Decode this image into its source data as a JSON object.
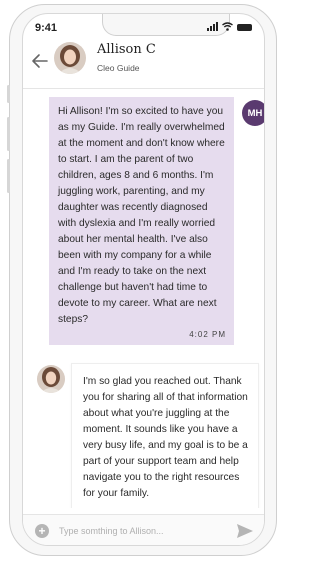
{
  "status_bar": {
    "time": "9:41"
  },
  "header": {
    "name": "Allison C",
    "subtitle": "Cleo Guide"
  },
  "messages": [
    {
      "sender_initials": "MH",
      "text": "Hi Allison! I'm so excited to have you as my Guide. I'm really overwhelmed at the moment and don't know where to start. I am the parent of two children, ages 8 and 6 months. I'm juggling work, parenting, and my daughter was recently diagnosed with dyslexia and I'm really worried about her mental health. I've also been with my company for a while and I'm ready to take on the next challenge but haven't had time to devote to my career. What are next steps?",
      "time": "4:02 PM"
    },
    {
      "text": "I'm so glad you reached out. Thank you for sharing all of that information about what you're juggling at the moment. It sounds like you have a very busy life, and my goal is to be a part of your support team and help navigate you to the right resources for your family."
    }
  ],
  "composer": {
    "placeholder": "Type somthing to Allison..."
  },
  "colors": {
    "user_bubble": "#e6dcee",
    "badge": "#5a3a6f",
    "send_icon": "#b5b5b5"
  }
}
